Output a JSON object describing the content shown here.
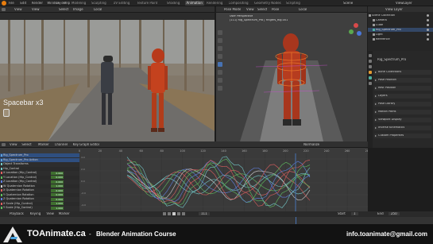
{
  "menu": [
    "File",
    "Edit",
    "Render",
    "Window",
    "Help"
  ],
  "workspaces": [
    "Layout",
    "Modeling",
    "Sculpting",
    "UV Editing",
    "Texture Paint",
    "Shading",
    "Animation",
    "Rendering",
    "Compositing",
    "Geometry Nodes",
    "Scripting"
  ],
  "active_workspace": "Animation",
  "scene_name": "Scene",
  "view_layer": "ViewLayer",
  "image_editor": {
    "mode": "View",
    "image_menu": "Image",
    "select_menu": "Select",
    "view_menu": "View",
    "frame_mode": "Local",
    "overlay": "Spacebar x3"
  },
  "viewport": {
    "mode": "Pose Mode",
    "menus": [
      "View",
      "Select",
      "Pose"
    ],
    "header_line": "User Perspective",
    "object_line": "(111) Rig_Spectrum_Pro | Fingers_Rig.001",
    "transform": "Local"
  },
  "outliner": {
    "title": "Scene Collection",
    "view_layer": "View Layer",
    "items": [
      "Scene Collection",
      "Camera",
      "Cube",
      "Rig_Spectrum_Pro",
      "Light",
      "Reference"
    ]
  },
  "properties": {
    "object": "Rig_Spectrum_Pro",
    "sections": [
      "Bone Collections",
      "Pose Position",
      "Rest Position",
      "Layers",
      "Pose Library",
      "Motion Paths",
      "Viewport Display",
      "Inverse Kinematics",
      "Custom Properties"
    ]
  },
  "graph_editor": {
    "menus": [
      "View",
      "Select",
      "Marker",
      "Channel",
      "Key"
    ],
    "mode": "Graph Editor",
    "normalize": "Normalize",
    "y_labels": [
      "4.0",
      "2.0",
      "0.0",
      "-2.0",
      "-4.0"
    ],
    "x_labels": [
      "0",
      "20",
      "40",
      "60",
      "80",
      "100",
      "120",
      "140",
      "160",
      "180",
      "200",
      "220",
      "240",
      "260",
      "280"
    ],
    "channels": [
      {
        "name": "Rig_Spectrum_Pro",
        "value": "",
        "color": "#5fa1d8"
      },
      {
        "name": "Rig_Spectrum_Pro Action",
        "value": "",
        "color": "#5fa1d8"
      },
      {
        "name": "Object Transforms",
        "value": "",
        "color": "#74c9c9"
      },
      {
        "name": "Hip_Control",
        "value": "",
        "color": "#74c9c9"
      },
      {
        "name": "X Location (Hip_Control)",
        "value": "0.000",
        "color": "#e06060"
      },
      {
        "name": "Y Location (Hip_Control)",
        "value": "0.000",
        "color": "#60c060"
      },
      {
        "name": "Z Location (Hip_Control)",
        "value": "0.000",
        "color": "#6080e0"
      },
      {
        "name": "W Quaternion Rotation",
        "value": "1.000",
        "color": "#d0d0d0"
      },
      {
        "name": "X Quaternion Rotation",
        "value": "0.000",
        "color": "#e06060"
      },
      {
        "name": "Y Quaternion Rotation",
        "value": "0.000",
        "color": "#60c060"
      },
      {
        "name": "Z Quaternion Rotation",
        "value": "0.000",
        "color": "#6080e0"
      },
      {
        "name": "X Scale (Hip_Control)",
        "value": "1.000",
        "color": "#e06060"
      },
      {
        "name": "Y Scale (Hip_Control)",
        "value": "1.000",
        "color": "#60c060"
      }
    ]
  },
  "timeline": {
    "menus": [
      "Playback",
      "Keying",
      "View",
      "Marker"
    ],
    "current_frame": "111",
    "start_label": "Start",
    "start": "1",
    "end_label": "End",
    "end": "250"
  },
  "banner": {
    "site": "TOAnimate.ca",
    "separator": "-",
    "course": "Blender Animation Course",
    "email": "info.toanimate@gmail.com"
  },
  "colors": {
    "accent": "#4772b3",
    "banner_bg": "#121212",
    "selected_blue": "#2f4f80"
  }
}
